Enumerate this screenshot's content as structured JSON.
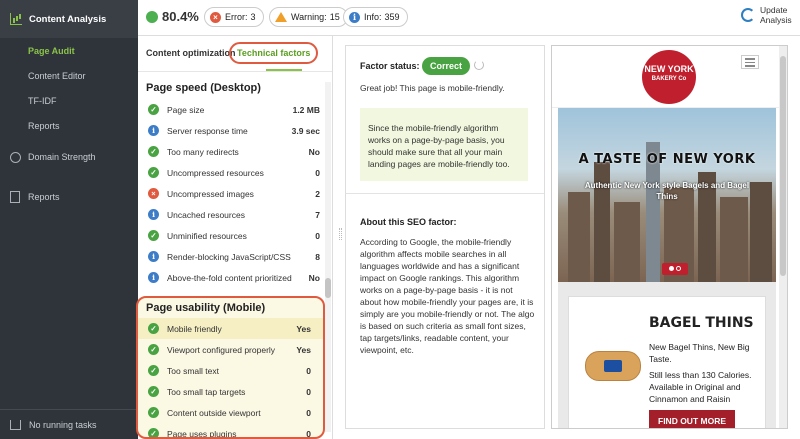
{
  "sidebar": {
    "header_label": "Content Analysis",
    "sub_items": [
      {
        "label": "Page Audit"
      },
      {
        "label": "Content Editor"
      },
      {
        "label": "TF-IDF"
      },
      {
        "label": "Reports"
      }
    ],
    "items": [
      {
        "label": "Domain Strength",
        "icon": "gauge-icon"
      },
      {
        "label": "Reports",
        "icon": "document-icon"
      }
    ],
    "bottom_label": "No running tasks"
  },
  "topbar": {
    "score": "80.4%",
    "error_label": "Error:",
    "error_count": "3",
    "warning_label": "Warning:",
    "warning_count": "15",
    "info_label": "Info:",
    "info_count": "359",
    "update_label": "Update Analysis",
    "colors": {
      "score_dot": "#4caf50",
      "error": "#e05a3f",
      "warning": "#f0a02a",
      "info": "#3d7dc8"
    }
  },
  "tabs": {
    "content_optimization": "Content optimization",
    "technical_factors": "Technical factors"
  },
  "page_speed": {
    "title": "Page speed (Desktop)",
    "rows": [
      {
        "status": "ok",
        "label": "Page size",
        "value": "1.2 MB"
      },
      {
        "status": "info",
        "label": "Server response time",
        "value": "3.9 sec"
      },
      {
        "status": "ok",
        "label": "Too many redirects",
        "value": "No"
      },
      {
        "status": "ok",
        "label": "Uncompressed resources",
        "value": "0"
      },
      {
        "status": "error",
        "label": "Uncompressed images",
        "value": "2"
      },
      {
        "status": "info",
        "label": "Uncached resources",
        "value": "7"
      },
      {
        "status": "ok",
        "label": "Unminified resources",
        "value": "0"
      },
      {
        "status": "info",
        "label": "Render-blocking JavaScript/CSS",
        "value": "8"
      },
      {
        "status": "info",
        "label": "Above-the-fold content prioritized",
        "value": "No"
      }
    ]
  },
  "page_usability": {
    "title": "Page usability (Mobile)",
    "rows": [
      {
        "status": "ok",
        "label": "Mobile friendly",
        "value": "Yes"
      },
      {
        "status": "ok",
        "label": "Viewport configured properly",
        "value": "Yes"
      },
      {
        "status": "ok",
        "label": "Too small text",
        "value": "0"
      },
      {
        "status": "ok",
        "label": "Too small tap targets",
        "value": "0"
      },
      {
        "status": "ok",
        "label": "Content outside viewport",
        "value": "0"
      },
      {
        "status": "ok",
        "label": "Page uses plugins",
        "value": "0"
      }
    ]
  },
  "factor": {
    "status_label": "Factor status:",
    "status_value": "Correct",
    "message": "Great job! This page is mobile-friendly.",
    "note": "Since the mobile-friendly algorithm works on a page-by-page basis, you should make sure that all your main landing pages are mobile-friendly too.",
    "about_title": "About this SEO factor:",
    "about_body": "According to Google, the mobile-friendly algorithm affects mobile searches in all languages worldwide and has a significant impact on Google rankings. This algorithm works on a page-by-page basis - it is not about how mobile-friendly your pages are, it is simply are you mobile-friendly or not. The algo is based on such criteria as small font sizes, tap targets/links, readable content, your viewpoint, etc."
  },
  "preview": {
    "logo_line1": "NEW YORK",
    "logo_line2": "BAKERY Co",
    "hero_title": "A TASTE OF NEW YORK",
    "hero_subtitle": "Authentic New York style Bagels and Bagel Thins",
    "card_title": "BAGEL THINS",
    "card_text1": "New Bagel Thins, New Big Taste.",
    "card_text2": "Still less than 130 Calories. Available in Original and Cinnamon and Raisin",
    "cta_label": "FIND OUT MORE"
  }
}
